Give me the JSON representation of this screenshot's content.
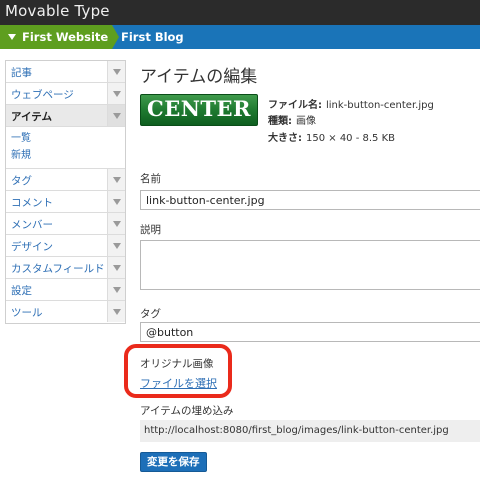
{
  "app": {
    "title": "Movable Type"
  },
  "scope": {
    "website": "First Website",
    "blog": "First Blog"
  },
  "sidebar": {
    "items": [
      {
        "label": "記事"
      },
      {
        "label": "ウェブページ"
      },
      {
        "label": "アイテム",
        "active": true,
        "subitems": [
          "一覧",
          "新規"
        ]
      },
      {
        "label": "タグ"
      },
      {
        "label": "コメント"
      },
      {
        "label": "メンバー"
      },
      {
        "label": "デザイン"
      },
      {
        "label": "カスタムフィールド"
      },
      {
        "label": "設定"
      },
      {
        "label": "ツール"
      }
    ]
  },
  "page": {
    "title": "アイテムの編集"
  },
  "asset": {
    "thumbnail_text": "CENTER",
    "file_name_label": "ファイル名:",
    "file_name": "link-button-center.jpg",
    "type_label": "種類:",
    "type": "画像",
    "size_label": "大きさ:",
    "size": "150 × 40 - 8.5 KB"
  },
  "form": {
    "name_label": "名前",
    "name_value": "link-button-center.jpg",
    "description_label": "説明",
    "tags_label": "タグ",
    "tags_value": "@button",
    "original_image_label": "オリジナル画像",
    "choose_file": "ファイルを選択",
    "embed_label": "アイテムの埋め込み",
    "embed_url": "http://localhost:8080/first_blog/images/link-button-center.jpg",
    "save_button": "変更を保存"
  },
  "colors": {
    "topbar": "#2b2b2b",
    "scopebar": "#1a74b8",
    "website_scope": "#5e9e1f",
    "link": "#2e6fb5",
    "highlight": "#ea2a1b",
    "primary_button": "#1d6fb8"
  }
}
